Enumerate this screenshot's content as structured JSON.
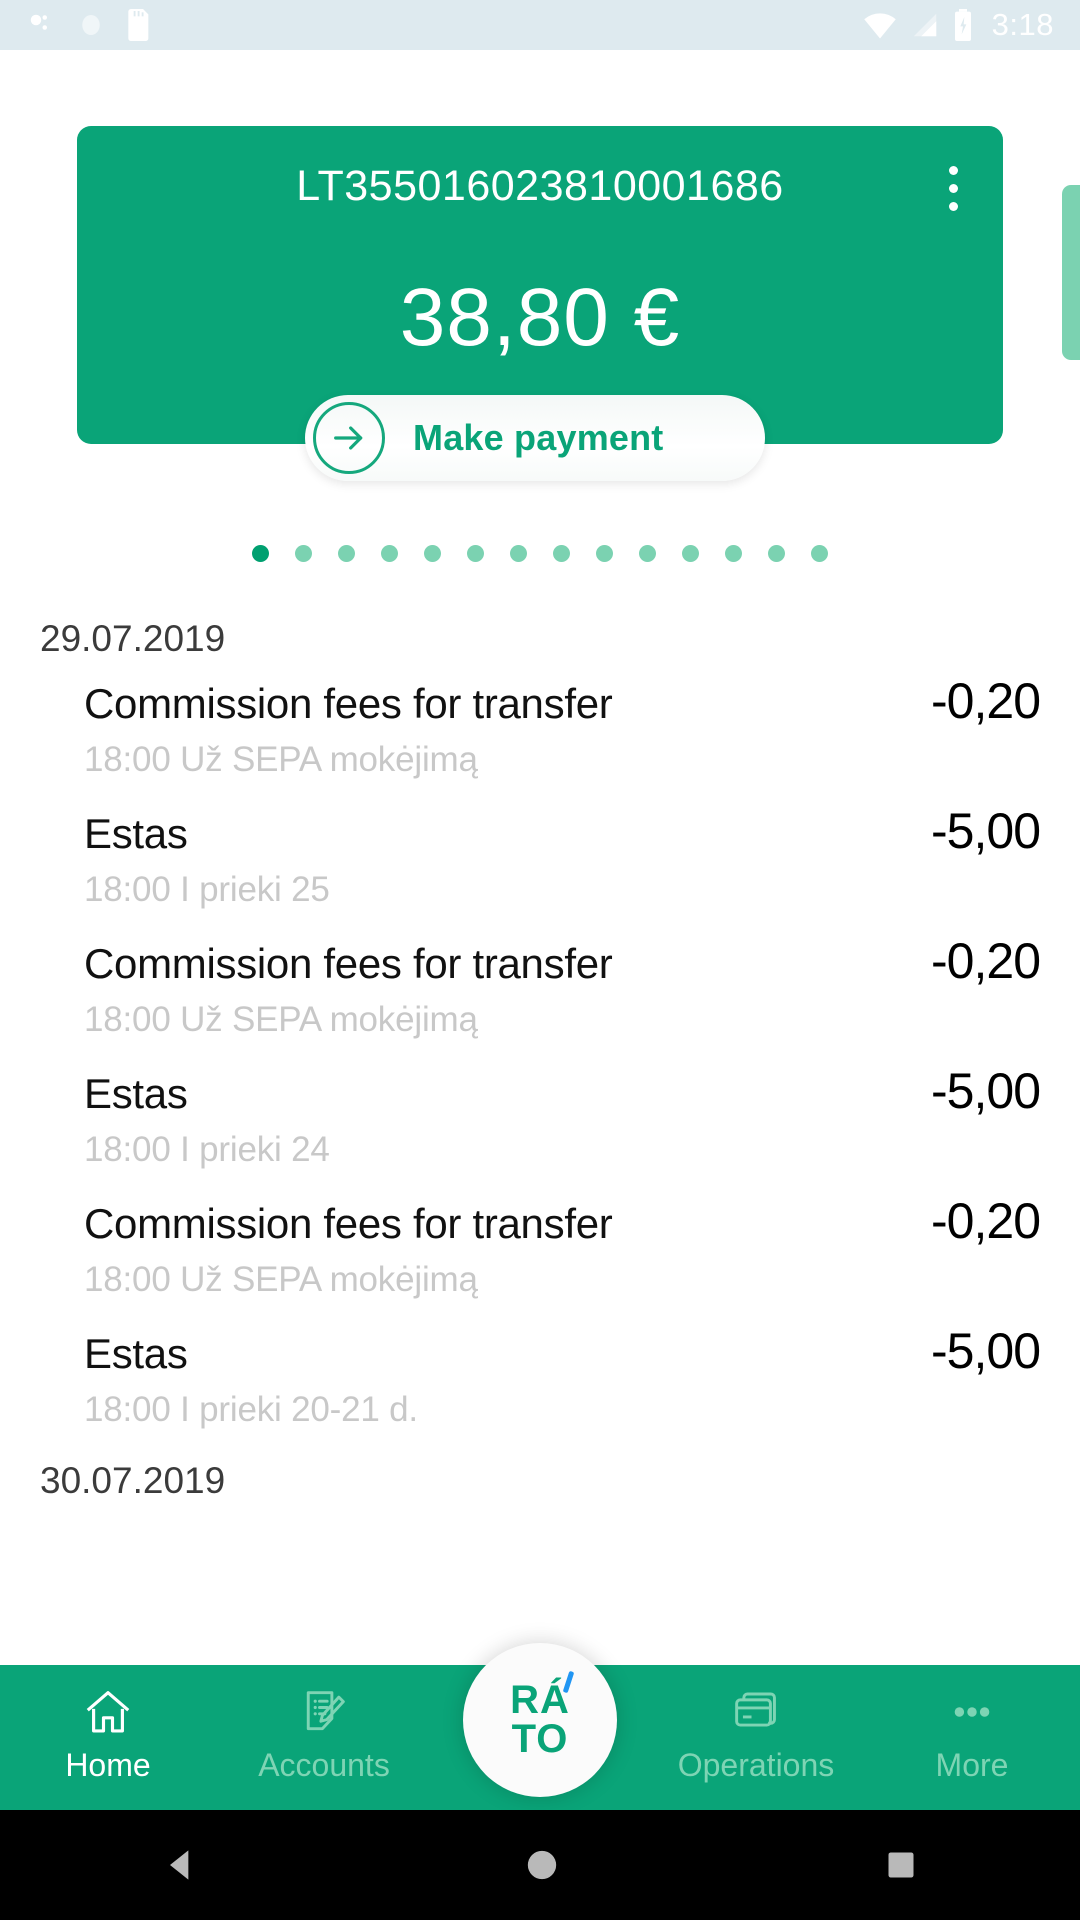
{
  "status_bar": {
    "time": "3:18",
    "icons": [
      "bluetooth-icon",
      "sync-icon",
      "sd-card-icon",
      "wifi-icon",
      "cellular-signal-icon",
      "battery-charging-icon"
    ]
  },
  "account_card": {
    "iban": "LT355016023810001686",
    "balance": "38,80 €",
    "overflow_label": "overflow-menu",
    "bg_color": "#0aa478"
  },
  "make_payment": {
    "label": "Make payment",
    "arrow": "→",
    "accent_color": "#0aa478"
  },
  "pager": {
    "total": 14,
    "active_index": 0,
    "active_color": "#00a070",
    "inactive_color": "#7bd2b1"
  },
  "transactions": {
    "groups": [
      {
        "date": "29.07.2019",
        "rows": [
          {
            "title": "Commission fees for transfer",
            "sub": "18:00 Už SEPA mokėjimą",
            "amount": "-0,20"
          },
          {
            "title": "Estas",
            "sub": "18:00 I prieki 25",
            "amount": "-5,00"
          },
          {
            "title": "Commission fees for transfer",
            "sub": "18:00 Už SEPA mokėjimą",
            "amount": "-0,20"
          },
          {
            "title": "Estas",
            "sub": "18:00 I prieki 24",
            "amount": "-5,00"
          },
          {
            "title": "Commission fees for transfer",
            "sub": "18:00 Už SEPA mokėjimą",
            "amount": "-0,20"
          },
          {
            "title": "Estas",
            "sub": "18:00 I prieki 20-21 d.",
            "amount": "-5,00"
          }
        ]
      },
      {
        "date": "30.07.2019",
        "rows": []
      }
    ]
  },
  "bottom_nav": {
    "items": [
      {
        "label": "Home",
        "icon": "home-icon",
        "active": true
      },
      {
        "label": "Accounts",
        "icon": "document-edit-icon",
        "active": false
      },
      {
        "label": "Operations",
        "icon": "cards-icon",
        "active": false
      },
      {
        "label": "More",
        "icon": "ellipsis-icon",
        "active": false
      }
    ],
    "fab": {
      "line1": "RÁ",
      "line2": "TO",
      "accent_color": "#2196f3",
      "text_color": "#0aa478"
    },
    "bg_color": "#0aa478"
  },
  "android_bar": {
    "back": "back-triangle-icon",
    "home": "home-circle-icon",
    "recents": "recents-square-icon"
  }
}
